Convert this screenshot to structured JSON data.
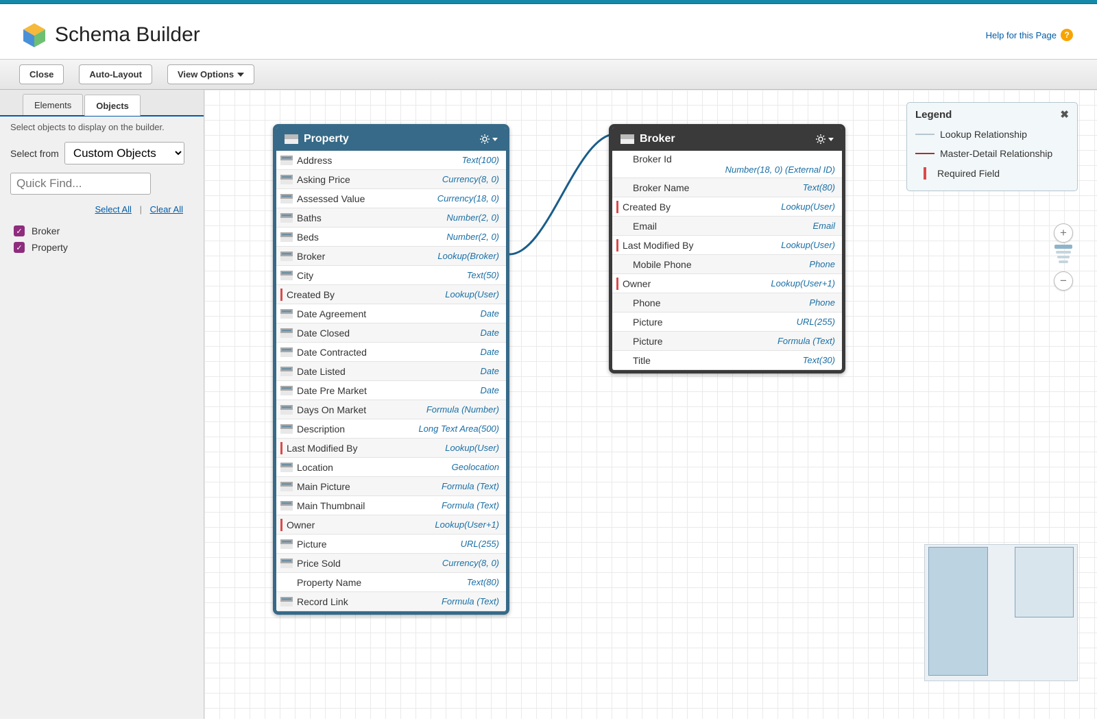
{
  "header": {
    "title": "Schema Builder",
    "help_label": "Help for this Page"
  },
  "toolbar": {
    "close": "Close",
    "auto_layout": "Auto-Layout",
    "view_options": "View Options"
  },
  "sidebar": {
    "tabs": {
      "elements": "Elements",
      "objects": "Objects"
    },
    "instruction": "Select objects to display on the builder.",
    "select_from_label": "Select from",
    "select_from_value": "Custom Objects",
    "quick_find_placeholder": "Quick Find...",
    "select_all": "Select All",
    "clear_all": "Clear All",
    "items": [
      {
        "label": "Broker",
        "checked": true
      },
      {
        "label": "Property",
        "checked": true
      }
    ]
  },
  "legend": {
    "title": "Legend",
    "lookup": "Lookup Relationship",
    "master": "Master-Detail Relationship",
    "required": "Required Field"
  },
  "objects": {
    "property": {
      "title": "Property",
      "fields": [
        {
          "name": "Address",
          "type": "Text(100)",
          "icon": true
        },
        {
          "name": "Asking Price",
          "type": "Currency(8, 0)",
          "icon": true
        },
        {
          "name": "Assessed Value",
          "type": "Currency(18, 0)",
          "icon": true
        },
        {
          "name": "Baths",
          "type": "Number(2, 0)",
          "icon": true
        },
        {
          "name": "Beds",
          "type": "Number(2, 0)",
          "icon": true
        },
        {
          "name": "Broker",
          "type": "Lookup(Broker)",
          "icon": true
        },
        {
          "name": "City",
          "type": "Text(50)",
          "icon": true
        },
        {
          "name": "Created By",
          "type": "Lookup(User)",
          "required": true
        },
        {
          "name": "Date Agreement",
          "type": "Date",
          "icon": true
        },
        {
          "name": "Date Closed",
          "type": "Date",
          "icon": true
        },
        {
          "name": "Date Contracted",
          "type": "Date",
          "icon": true
        },
        {
          "name": "Date Listed",
          "type": "Date",
          "icon": true
        },
        {
          "name": "Date Pre Market",
          "type": "Date",
          "icon": true
        },
        {
          "name": "Days On Market",
          "type": "Formula (Number)",
          "icon": true
        },
        {
          "name": "Description",
          "type": "Long Text Area(500)",
          "icon": true
        },
        {
          "name": "Last Modified By",
          "type": "Lookup(User)",
          "required": true
        },
        {
          "name": "Location",
          "type": "Geolocation",
          "icon": true
        },
        {
          "name": "Main Picture",
          "type": "Formula (Text)",
          "icon": true
        },
        {
          "name": "Main Thumbnail",
          "type": "Formula (Text)",
          "icon": true
        },
        {
          "name": "Owner",
          "type": "Lookup(User+1)",
          "required": true
        },
        {
          "name": "Picture",
          "type": "URL(255)",
          "icon": true
        },
        {
          "name": "Price Sold",
          "type": "Currency(8, 0)",
          "icon": true
        },
        {
          "name": "Property Name",
          "type": "Text(80)"
        },
        {
          "name": "Record Link",
          "type": "Formula (Text)",
          "icon": true
        }
      ]
    },
    "broker": {
      "title": "Broker",
      "fields": [
        {
          "name": "Broker Id",
          "type": "Number(18, 0) (External ID)",
          "idrow": true
        },
        {
          "name": "Broker Name",
          "type": "Text(80)"
        },
        {
          "name": "Created By",
          "type": "Lookup(User)",
          "required": true
        },
        {
          "name": "Email",
          "type": "Email"
        },
        {
          "name": "Last Modified By",
          "type": "Lookup(User)",
          "required": true
        },
        {
          "name": "Mobile Phone",
          "type": "Phone"
        },
        {
          "name": "Owner",
          "type": "Lookup(User+1)",
          "required": true
        },
        {
          "name": "Phone",
          "type": "Phone"
        },
        {
          "name": "Picture",
          "type": "URL(255)"
        },
        {
          "name": "Picture",
          "type": "Formula (Text)"
        },
        {
          "name": "Title",
          "type": "Text(30)"
        }
      ]
    }
  }
}
